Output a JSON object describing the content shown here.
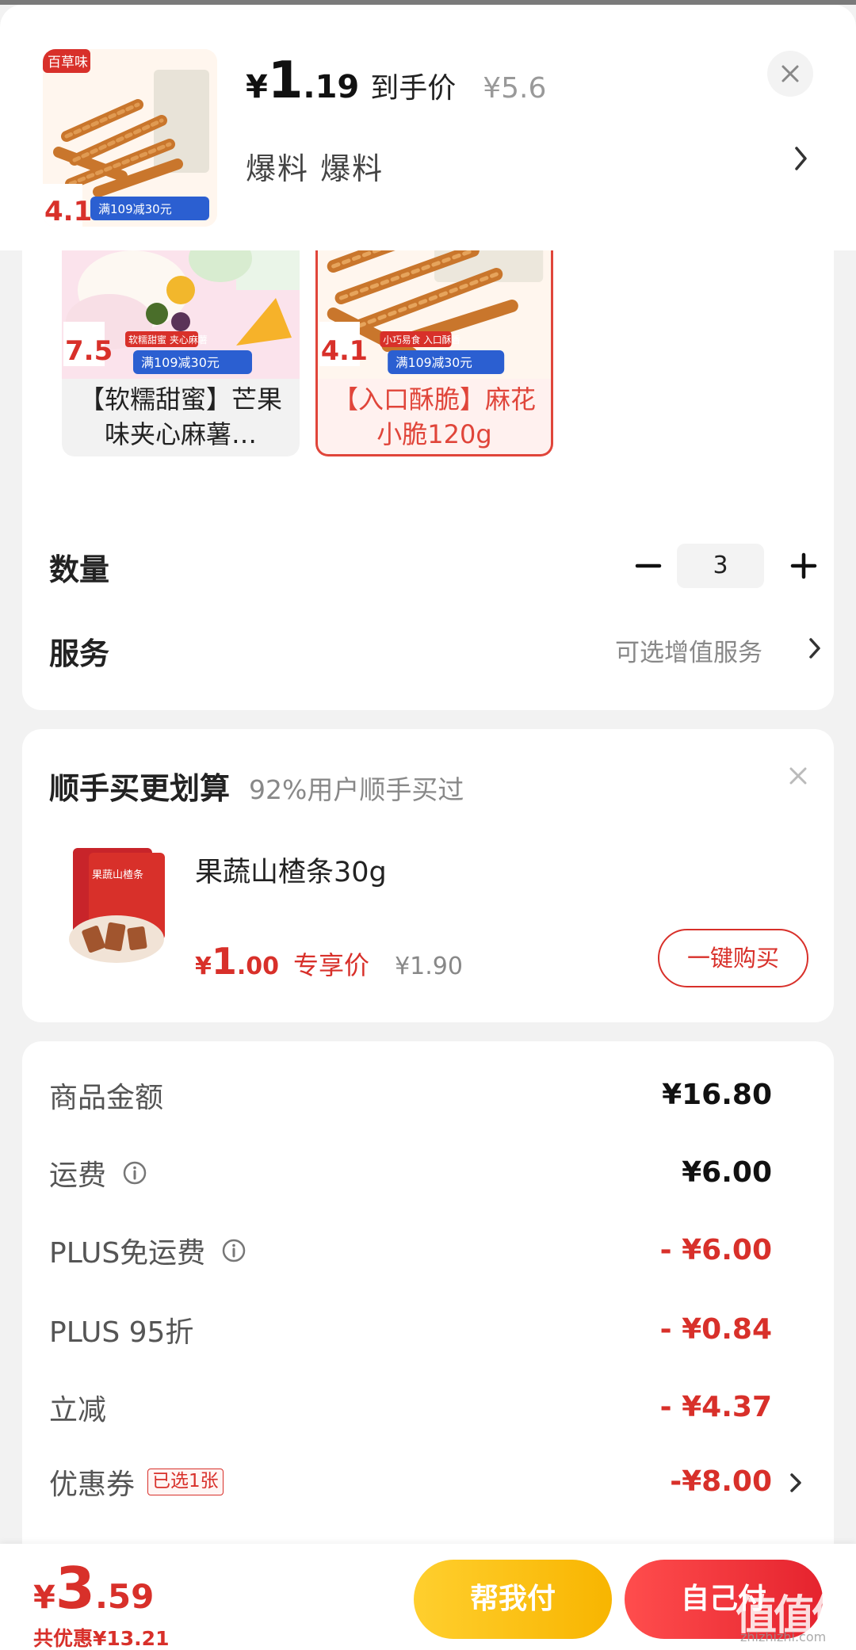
{
  "header": {
    "price_yen": "¥",
    "price_int": "1",
    "price_dec": ".19",
    "price_tag": "到手价",
    "original_price": "¥5.6",
    "spec_text": "爆料 爆料",
    "thumb_brand": "百草味",
    "thumb_badge_price": "4.1",
    "thumb_promo": "满109减30元"
  },
  "variants": [
    {
      "label": "【软糯甜蜜】芒果味夹心麻薯…",
      "badge_price": "7.5",
      "promo": "满109减30元",
      "tag": "软糯甜蜜 夹心麻薯",
      "selected": false
    },
    {
      "label": "【入口酥脆】麻花小脆120g",
      "badge_price": "4.1",
      "promo": "满109减30元",
      "tag": "小巧易食 入口酥香",
      "selected": true
    }
  ],
  "quantity": {
    "label": "数量",
    "value": "3"
  },
  "service": {
    "label": "服务",
    "value": "可选增值服务"
  },
  "bundle": {
    "title": "顺手买更划算",
    "subtitle": "92%用户顺手买过",
    "product_name": "果蔬山楂条30g",
    "product_pack_text": "果蔬山楂条",
    "price_yen": "¥",
    "price_int": "1",
    "price_dec": ".00",
    "price_tag": "专享价",
    "original_price": "¥1.90",
    "buy_label": "一键购买"
  },
  "breakdown": [
    {
      "label": "商品金额",
      "value": "¥16.80",
      "red": false,
      "info": false
    },
    {
      "label": "运费",
      "value": "¥6.00",
      "red": false,
      "info": true
    },
    {
      "label": "PLUS免运费",
      "value": "- ¥6.00",
      "red": true,
      "info": true
    },
    {
      "label": "PLUS 95折",
      "value": "- ¥0.84",
      "red": true,
      "info": false
    },
    {
      "label": "立减",
      "value": "- ¥4.37",
      "red": true,
      "info": false
    },
    {
      "label": "优惠券",
      "value": "-¥8.00",
      "red": true,
      "info": false,
      "tag": "已选1张"
    }
  ],
  "bottom": {
    "total_yen": "¥",
    "total_int": "3",
    "total_dec": ".59",
    "saved": "共优惠¥13.21",
    "help_pay": "帮我付",
    "self_pay": "自己付"
  },
  "watermark": {
    "text": "值值值",
    "sub": "zhizhizhi.com"
  },
  "colors": {
    "accent_red": "#d8302a",
    "pay_yellow": "#f8b500",
    "pay_red": "#e5232e"
  }
}
